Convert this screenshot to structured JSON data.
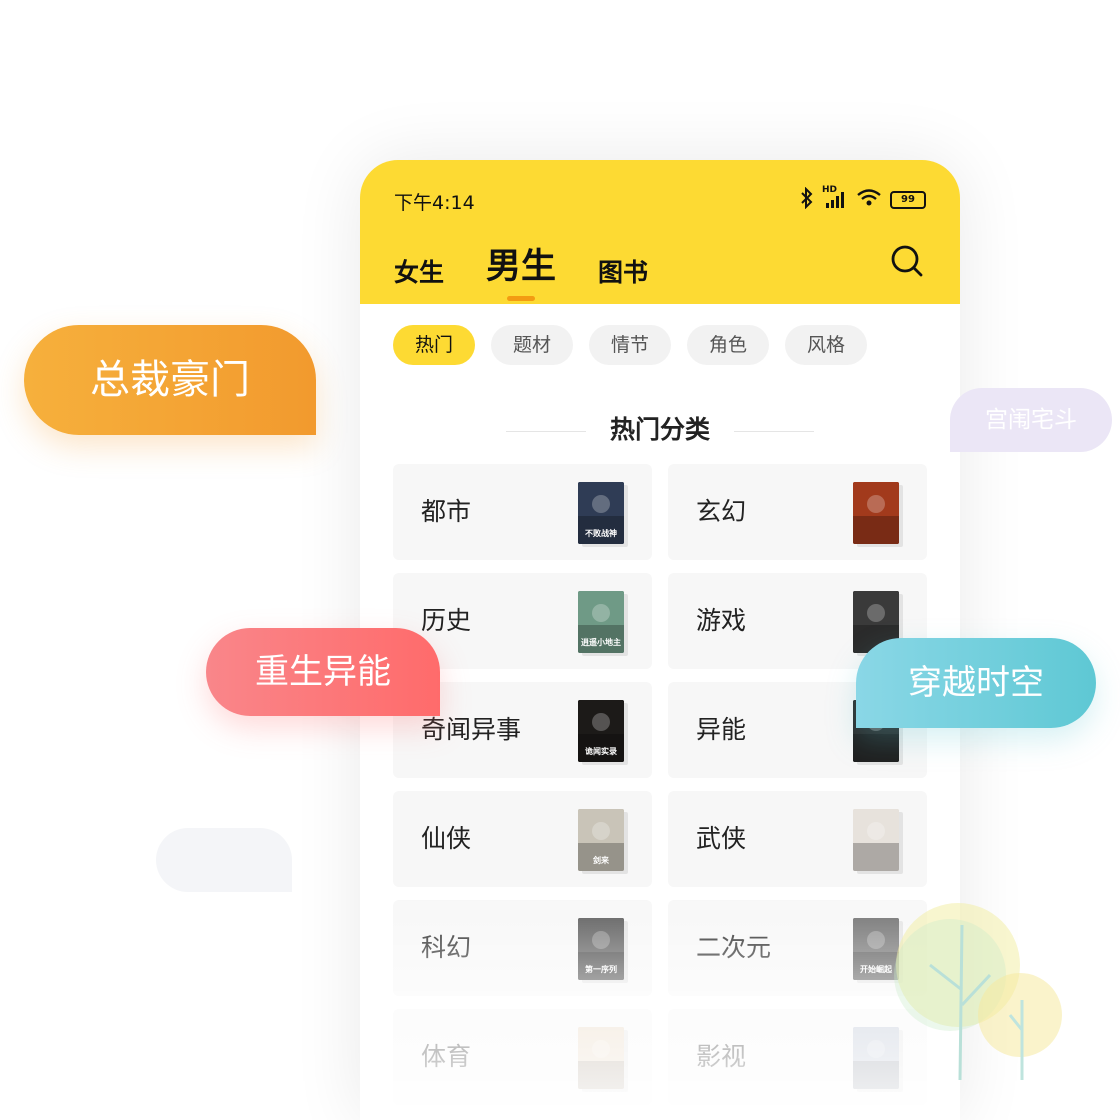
{
  "status_bar": {
    "time": "下午4:14",
    "hd": "HD",
    "battery": "99"
  },
  "tabs": [
    {
      "label": "女生",
      "active": false
    },
    {
      "label": "男生",
      "active": true
    },
    {
      "label": "图书",
      "active": false
    }
  ],
  "filters": [
    {
      "label": "热门",
      "active": true
    },
    {
      "label": "题材",
      "active": false
    },
    {
      "label": "情节",
      "active": false
    },
    {
      "label": "角色",
      "active": false
    },
    {
      "label": "风格",
      "active": false
    }
  ],
  "section_title": "热门分类",
  "categories": [
    {
      "label": "都市",
      "cover_title": "不败战神",
      "cover_color": "#2f3c55"
    },
    {
      "label": "玄幻",
      "cover_title": "",
      "cover_color": "#a23a1c"
    },
    {
      "label": "历史",
      "cover_title": "逍遥小地主",
      "cover_color": "#6f9a86"
    },
    {
      "label": "游戏",
      "cover_title": "",
      "cover_color": "#3a3a3a"
    },
    {
      "label": "奇闻异事",
      "cover_title": "诡闻实录",
      "cover_color": "#1c1a18"
    },
    {
      "label": "异能",
      "cover_title": "",
      "cover_color": "#2a2a2a"
    },
    {
      "label": "仙侠",
      "cover_title": "剑来",
      "cover_color": "#c9c4b8"
    },
    {
      "label": "武侠",
      "cover_title": "",
      "cover_color": "#e7e2dc"
    },
    {
      "label": "科幻",
      "cover_title": "第一序列",
      "cover_color": "#555555"
    },
    {
      "label": "二次元",
      "cover_title": "开始崛起",
      "cover_color": "#6b6b6b"
    },
    {
      "label": "体育",
      "cover_title": "",
      "cover_color": "#e8d6c0"
    },
    {
      "label": "影视",
      "cover_title": "",
      "cover_color": "#b9c2d2"
    }
  ],
  "bubbles": {
    "b1": "总裁豪门",
    "b2": "重生异能",
    "b3": "穿越时空",
    "b4": "宫闱宅斗"
  },
  "colors": {
    "header_yellow": "#fdda33",
    "tab_indicator": "#f39c12"
  }
}
